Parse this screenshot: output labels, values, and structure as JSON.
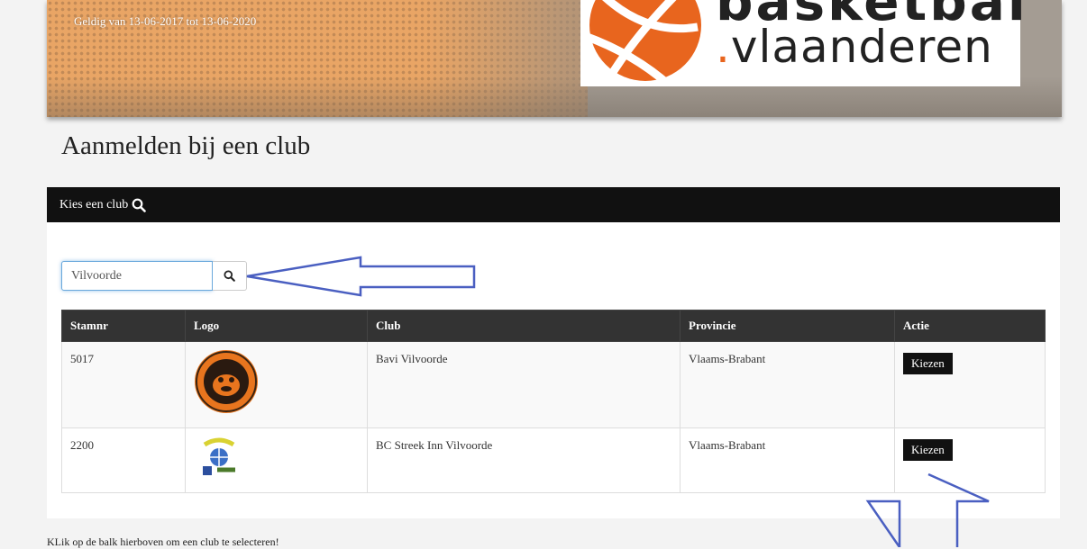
{
  "banner": {
    "validity": "Geldig van 13-06-2017 tot 13-06-2020",
    "logo_top": "basketbal",
    "logo_dot": ".",
    "logo_text": "vlaanderen"
  },
  "page_title": "Aanmelden bij een club",
  "panel": {
    "header_label": "Kies een club",
    "search": {
      "value": "Vilvoorde",
      "placeholder": ""
    },
    "table": {
      "columns": [
        "Stamnr",
        "Logo",
        "Club",
        "Provincie",
        "Actie"
      ],
      "rows": [
        {
          "stamnr": "5017",
          "club": "Bavi Vilvoorde",
          "provincie": "Vlaams-Brabant",
          "action": "Kiezen"
        },
        {
          "stamnr": "2200",
          "club": "BC Streek Inn Vilvoorde",
          "provincie": "Vlaams-Brabant",
          "action": "Kiezen"
        }
      ]
    }
  },
  "footer_note": "KLik op de balk hierboven om een club te selecteren!",
  "colors": {
    "accent": "#e8651e",
    "header_bg": "#111111",
    "table_header_bg": "#333333",
    "annotation_arrow": "#4a5fc1"
  }
}
